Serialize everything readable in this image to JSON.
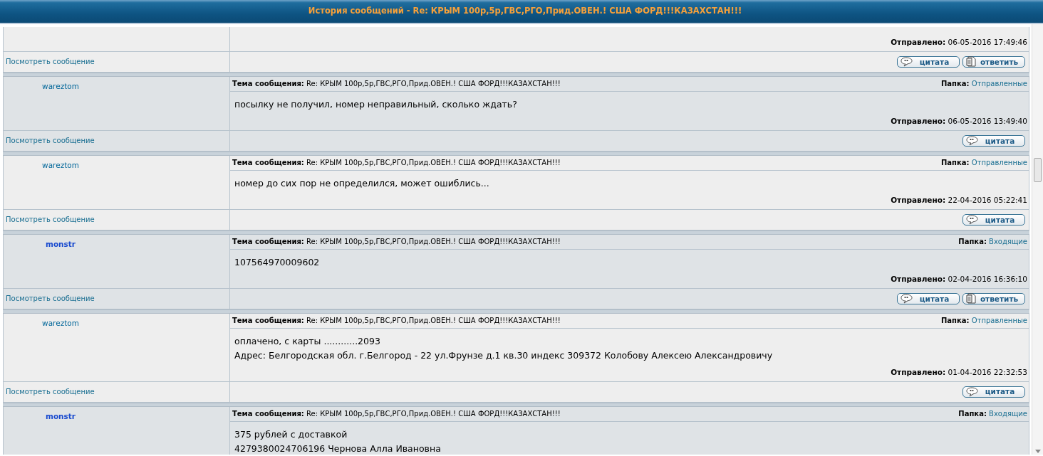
{
  "header": {
    "title": "История сообщений - Re: КРЫМ 100р,5р,ГВС,РГО,Прид.ОВЕН.! США ФОРД!!!КАЗАХСТАН!!!"
  },
  "messages": [
    {
      "sent_label": "Отправлено:",
      "sent": "06-05-2016 17:49:46",
      "view_link": "Посмотреть сообщение",
      "buttons": [
        {
          "kind": "quote",
          "label": "цитата"
        },
        {
          "kind": "reply",
          "label": "ответить"
        }
      ]
    },
    {
      "author": "wareztom",
      "author_highlighted": false,
      "subject_label": "Тема сообщения:",
      "subject": "Re: КРЫМ 100р,5р,ГВС,РГО,Прид.ОВЕН.! США ФОРД!!!КАЗАХСТАН!!!",
      "folder_label": "Папка:",
      "folder": "Отправленные",
      "body": [
        "посылку не получил, номер неправильный, сколько ждать?"
      ],
      "sent_label": "Отправлено:",
      "sent": "06-05-2016 13:49:40",
      "view_link": "Посмотреть сообщение",
      "buttons": [
        {
          "kind": "quote",
          "label": "цитата"
        }
      ]
    },
    {
      "author": "wareztom",
      "author_highlighted": false,
      "subject_label": "Тема сообщения:",
      "subject": "Re: КРЫМ 100р,5р,ГВС,РГО,Прид.ОВЕН.! США ФОРД!!!КАЗАХСТАН!!!",
      "folder_label": "Папка:",
      "folder": "Отправленные",
      "body": [
        "номер до сих пор не определился, может ошиблись..."
      ],
      "sent_label": "Отправлено:",
      "sent": "22-04-2016 05:22:41",
      "view_link": "Посмотреть сообщение",
      "buttons": [
        {
          "kind": "quote",
          "label": "цитата"
        }
      ]
    },
    {
      "author": "monstr",
      "author_highlighted": true,
      "subject_label": "Тема сообщения:",
      "subject": "Re: КРЫМ 100р,5р,ГВС,РГО,Прид.ОВЕН.! США ФОРД!!!КАЗАХСТАН!!!",
      "folder_label": "Папка:",
      "folder": "Входящие",
      "body": [
        "107564970009602"
      ],
      "sent_label": "Отправлено:",
      "sent": "02-04-2016 16:36:10",
      "view_link": "Посмотреть сообщение",
      "buttons": [
        {
          "kind": "quote",
          "label": "цитата"
        },
        {
          "kind": "reply",
          "label": "ответить"
        }
      ]
    },
    {
      "author": "wareztom",
      "author_highlighted": false,
      "subject_label": "Тема сообщения:",
      "subject": "Re: КРЫМ 100р,5р,ГВС,РГО,Прид.ОВЕН.! США ФОРД!!!КАЗАХСТАН!!!",
      "folder_label": "Папка:",
      "folder": "Отправленные",
      "body": [
        "оплачено, с карты ............2093",
        "Адрес: Белгородская обл. г.Белгород - 22 ул.Фрунзе д.1 кв.30 индекс 309372 Колобову Алексею Александровичу"
      ],
      "sent_label": "Отправлено:",
      "sent": "01-04-2016 22:32:53",
      "view_link": "Посмотреть сообщение",
      "buttons": [
        {
          "kind": "quote",
          "label": "цитата"
        }
      ]
    },
    {
      "author": "monstr",
      "author_highlighted": true,
      "subject_label": "Тема сообщения:",
      "subject": "Re: КРЫМ 100р,5р,ГВС,РГО,Прид.ОВЕН.! США ФОРД!!!КАЗАХСТАН!!!",
      "folder_label": "Папка:",
      "folder": "Входящие",
      "body": [
        "375 рублей с доставкой",
        "4279380024706196 Чернова Алла Ивановна"
      ]
    }
  ]
}
